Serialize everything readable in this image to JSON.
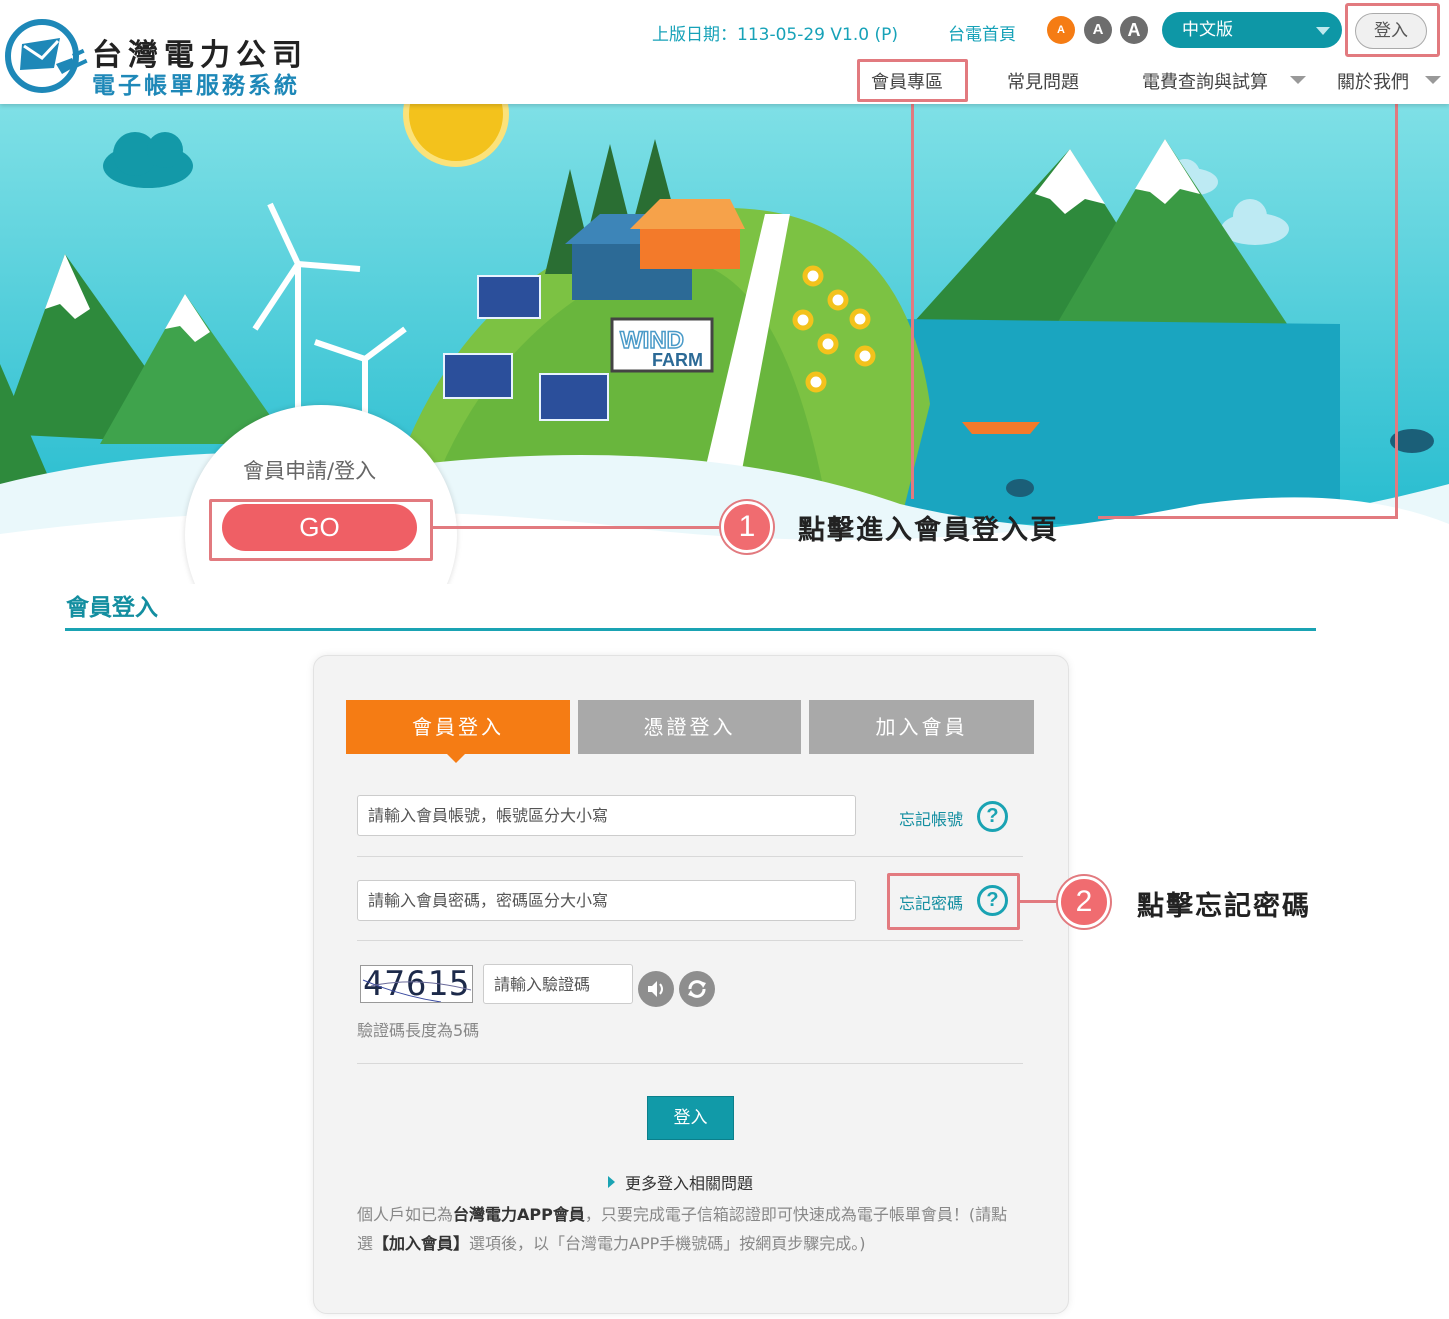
{
  "header": {
    "logo_title": "台灣電力公司",
    "logo_subtitle": "電子帳單服務系統",
    "version": "上版日期：113-05-29 V1.0 (P)",
    "home_link": "台電首頁",
    "font_sizes": [
      "A",
      "A",
      "A"
    ],
    "language": "中文版",
    "login_button": "登入",
    "nav": [
      "會員專區",
      "常見問題",
      "電費查詢與試算",
      "關於我們"
    ]
  },
  "banner": {
    "sign_line1": "WIND",
    "sign_line2": "FARM",
    "member_label": "會員申請/登入",
    "go_button": "GO"
  },
  "annotations": {
    "step1_number": "1",
    "step1_text": "點擊進入會員登入頁",
    "step2_number": "2",
    "step2_text": "點擊忘記密碼"
  },
  "section": {
    "title": "會員登入"
  },
  "login_card": {
    "tabs": [
      "會員登入",
      "憑證登入",
      "加入會員"
    ],
    "active_tab": 0,
    "account_placeholder": "請輸入會員帳號，帳號區分大小寫",
    "forgot_account": "忘記帳號",
    "password_placeholder": "請輸入會員密碼，密碼區分大小寫",
    "forgot_password": "忘記密碼",
    "captcha_image_text": "47615",
    "captcha_placeholder": "請輸入驗證碼",
    "captcha_hint": "驗證碼長度為5碼",
    "submit": "登入",
    "more_link": "更多登入相關問題",
    "note_part1": "個人戶如已為",
    "note_bold1": "台灣電力APP會員",
    "note_part2": "，只要完成電子信箱認證即可快速成為電子帳單會員！(請點選",
    "note_bold2": "【加入會員】",
    "note_part3": "選項後，以「台灣電力APP手機號碼」按網頁步驟完成。)"
  },
  "colors": {
    "brand_teal": "#119aa8",
    "tab_active": "#f57c14",
    "tab_inactive": "#a9a9a9",
    "highlight": "#e27a7f",
    "go_button": "#ef5f65"
  },
  "icons": {
    "logo": "envelope-plug-logo-icon",
    "help": "question-circle-icon",
    "audio": "speaker-icon",
    "refresh": "refresh-icon"
  }
}
